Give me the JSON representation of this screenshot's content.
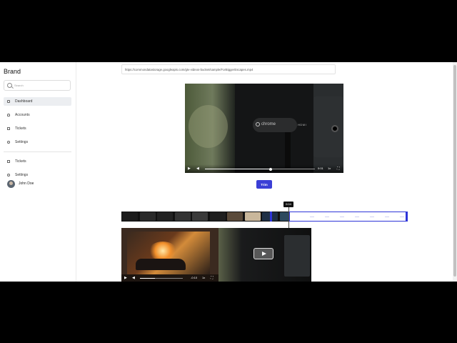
{
  "sidebar": {
    "brand": "Brand",
    "search_placeholder": "Search",
    "items": [
      {
        "label": "Dashboard",
        "icon": "house-icon",
        "active": true
      },
      {
        "label": "Accounts",
        "icon": "user-icon",
        "active": false
      },
      {
        "label": "Tickets",
        "icon": "ticket-icon",
        "active": false
      },
      {
        "label": "Settings",
        "icon": "gear-icon",
        "active": false
      }
    ],
    "bottom_items": [
      {
        "label": "Tickets",
        "icon": "ticket-icon"
      },
      {
        "label": "Settings",
        "icon": "gear-icon"
      }
    ],
    "user": {
      "name": "John Doe"
    }
  },
  "main": {
    "video_url": "https://commondatastorage.googleapis.com/gtv-videos-bucket/sample/ForBiggerEscapes.mp4",
    "player": {
      "brand_text": "chrome",
      "port_label": "HDMI",
      "time": "0:01",
      "speed": "1x",
      "progress": 0.6
    },
    "trim_button": "Trim",
    "timeline": {
      "playhead_time": "0:04",
      "selection_start": 0.52,
      "selection_end": 1.0
    },
    "preview_player": {
      "time": "-0:10",
      "speed": "1x",
      "progress": 0.35
    }
  },
  "colors": {
    "accent": "#3b3fd6",
    "selection_border": "#2e35d8",
    "active_nav_bg": "#eceef1"
  }
}
